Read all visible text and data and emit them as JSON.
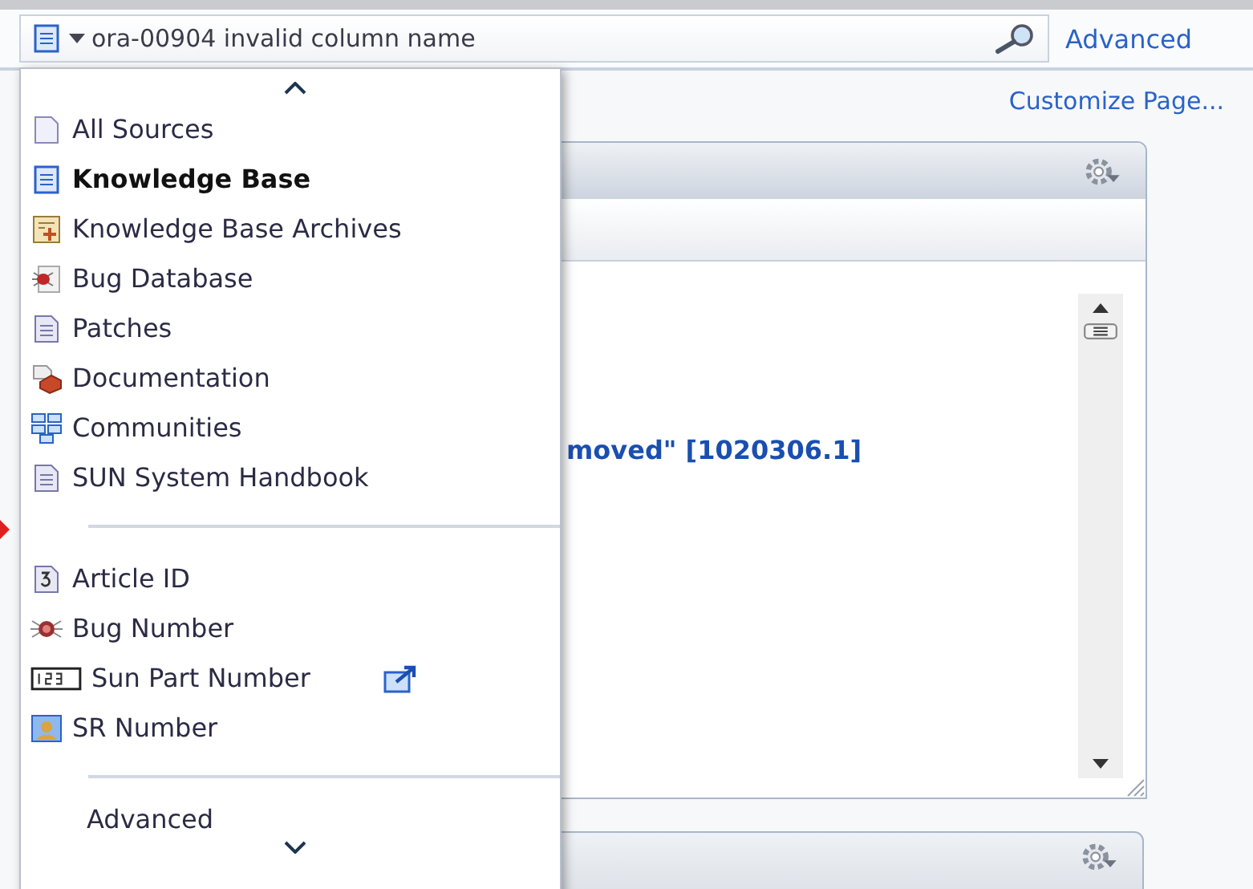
{
  "search": {
    "value": "ora-00904 invalid column name"
  },
  "advanced_link": "Advanced",
  "customize_link": "Customize Page...",
  "panel": {
    "result_text": "moved\" [1020306.1]"
  },
  "menu": {
    "sections": [
      {
        "items": [
          {
            "label": "All Sources",
            "kind": "blank",
            "selected": false
          },
          {
            "label": "Knowledge Base",
            "kind": "document",
            "selected": true
          },
          {
            "label": "Knowledge Base Archives",
            "kind": "archive",
            "selected": false
          },
          {
            "label": "Bug Database",
            "kind": "bug",
            "selected": false
          },
          {
            "label": "Patches",
            "kind": "page",
            "selected": false
          },
          {
            "label": "Documentation",
            "kind": "docs",
            "selected": false
          },
          {
            "label": "Communities",
            "kind": "network",
            "selected": false
          },
          {
            "label": "SUN System Handbook",
            "kind": "page",
            "selected": false
          }
        ]
      },
      {
        "items": [
          {
            "label": "Article ID",
            "kind": "numbered",
            "selected": false
          },
          {
            "label": "Bug Number",
            "kind": "bugnumber",
            "selected": false
          },
          {
            "label": "Sun Part Number",
            "kind": "digits",
            "selected": false,
            "external": true
          },
          {
            "label": "SR Number",
            "kind": "person",
            "selected": false
          }
        ]
      }
    ],
    "footer": "Advanced"
  }
}
